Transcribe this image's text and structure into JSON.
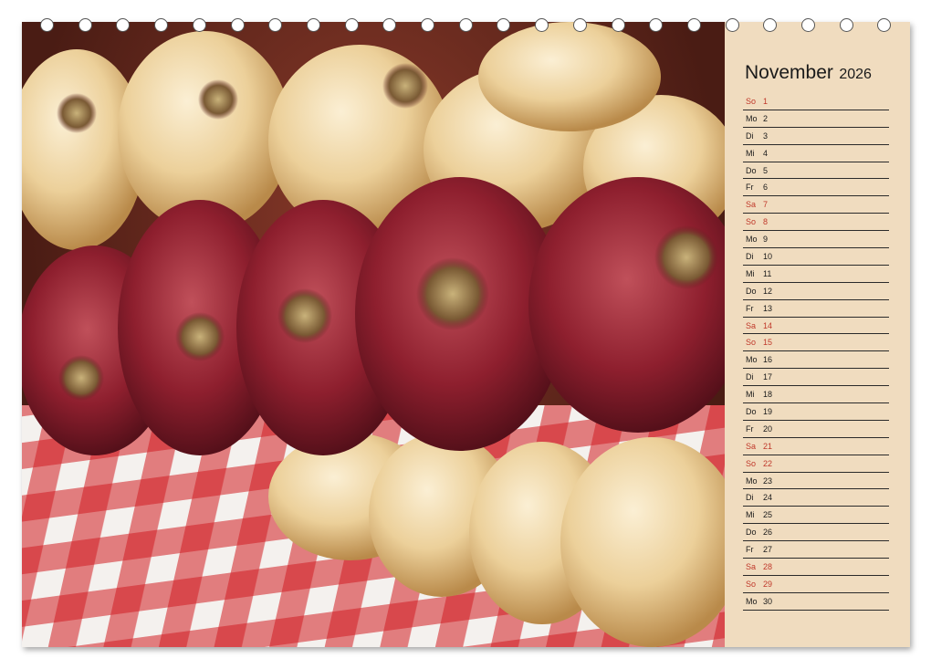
{
  "calendar": {
    "month": "November",
    "year": "2026",
    "days": [
      {
        "wd": "So",
        "d": "1",
        "weekend": true
      },
      {
        "wd": "Mo",
        "d": "2",
        "weekend": false
      },
      {
        "wd": "Di",
        "d": "3",
        "weekend": false
      },
      {
        "wd": "Mi",
        "d": "4",
        "weekend": false
      },
      {
        "wd": "Do",
        "d": "5",
        "weekend": false
      },
      {
        "wd": "Fr",
        "d": "6",
        "weekend": false
      },
      {
        "wd": "Sa",
        "d": "7",
        "weekend": true
      },
      {
        "wd": "So",
        "d": "8",
        "weekend": true
      },
      {
        "wd": "Mo",
        "d": "9",
        "weekend": false
      },
      {
        "wd": "Di",
        "d": "10",
        "weekend": false
      },
      {
        "wd": "Mi",
        "d": "11",
        "weekend": false
      },
      {
        "wd": "Do",
        "d": "12",
        "weekend": false
      },
      {
        "wd": "Fr",
        "d": "13",
        "weekend": false
      },
      {
        "wd": "Sa",
        "d": "14",
        "weekend": true
      },
      {
        "wd": "So",
        "d": "15",
        "weekend": true
      },
      {
        "wd": "Mo",
        "d": "16",
        "weekend": false
      },
      {
        "wd": "Di",
        "d": "17",
        "weekend": false
      },
      {
        "wd": "Mi",
        "d": "18",
        "weekend": false
      },
      {
        "wd": "Do",
        "d": "19",
        "weekend": false
      },
      {
        "wd": "Fr",
        "d": "20",
        "weekend": false
      },
      {
        "wd": "Sa",
        "d": "21",
        "weekend": true
      },
      {
        "wd": "So",
        "d": "22",
        "weekend": true
      },
      {
        "wd": "Mo",
        "d": "23",
        "weekend": false
      },
      {
        "wd": "Di",
        "d": "24",
        "weekend": false
      },
      {
        "wd": "Mi",
        "d": "25",
        "weekend": false
      },
      {
        "wd": "Do",
        "d": "26",
        "weekend": false
      },
      {
        "wd": "Fr",
        "d": "27",
        "weekend": false
      },
      {
        "wd": "Sa",
        "d": "28",
        "weekend": true
      },
      {
        "wd": "So",
        "d": "29",
        "weekend": true
      },
      {
        "wd": "Mo",
        "d": "30",
        "weekend": false
      }
    ]
  },
  "colors": {
    "weekend": "#c0392b",
    "panel": "#f0dcbf",
    "text": "#1a1a1a"
  }
}
